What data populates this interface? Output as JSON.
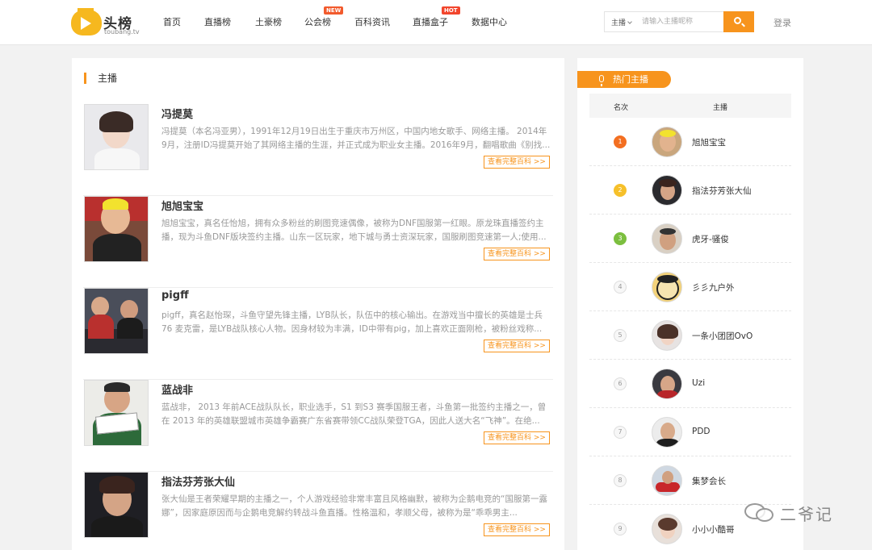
{
  "brand": {
    "name": "头榜",
    "sub": "toubang.tv"
  },
  "nav": [
    {
      "label": "首页"
    },
    {
      "label": "直播榜"
    },
    {
      "label": "土豪榜"
    },
    {
      "label": "公会榜",
      "badge": "NEW"
    },
    {
      "label": "百科资讯"
    },
    {
      "label": "直播盒子",
      "badge": "HOT"
    },
    {
      "label": "数据中心"
    }
  ],
  "search": {
    "category": "主播",
    "placeholder": "请输入主播昵称"
  },
  "login": "登录",
  "main": {
    "section_title": "主播",
    "more_label": "查看完整百科 >>",
    "items": [
      {
        "name": "冯提莫",
        "desc": "冯提莫（本名冯亚男），1991年12月19日出生于重庆市万州区，中国内地女歌手、网络主播。 2014年9月，注册ID冯提莫开始了其网络主播的生涯，并正式成为职业女主播。2016年9月，翻唱歌曲《别找..."
      },
      {
        "name": "旭旭宝宝",
        "desc": "旭旭宝宝，真名任怡旭，拥有众多粉丝的刷图竞速偶像，被称为DNF国服第一红眼。原龙珠直播签约主播，现为斗鱼DNF版块签约主播。山东一区玩家，地下城与勇士资深玩家，国服刷图竞速第一人;使用..."
      },
      {
        "name": "pigff",
        "desc": "pigff，真名赵怡琛，斗鱼守望先锋主播，LYB队长，队伍中的核心输出。在游戏当中擅长的英雄是士兵76 麦克雷，是LYB战队核心人物。因身材较为丰满，ID中带有pig，加上喜欢正面刚枪，被粉丝戏称..."
      },
      {
        "name": "蓝战非",
        "desc": "蓝战非， 2013 年前ACE战队队长，职业选手，S1 到S3 赛季国服王者，斗鱼第一批签约主播之一，曾在 2013 年的英雄联盟城市英雄争霸赛广东省赛带领CC战队荣登TGA，因此人送大名“飞神”。在绝..."
      },
      {
        "name": "指法芬芳张大仙",
        "desc": "张大仙是王者荣耀早期的主播之一，个人游戏经验非常丰富且风格幽默，被称为企鹅电竞的“国服第一露娜”，因家庭原因而与企鹅电竞解约转战斗鱼直播。性格温和，孝顺父母，被称为是“乖乖男主..."
      }
    ]
  },
  "sidebar": {
    "title": "热门主播",
    "col_rank": "名次",
    "col_anchor": "主播",
    "rows": [
      {
        "rank": "1",
        "name": "旭旭宝宝"
      },
      {
        "rank": "2",
        "name": "指法芬芳张大仙"
      },
      {
        "rank": "3",
        "name": "虎牙-骚俊"
      },
      {
        "rank": "4",
        "name": "彡彡九户外"
      },
      {
        "rank": "5",
        "name": "一条小团团OvO"
      },
      {
        "rank": "6",
        "name": "Uzi"
      },
      {
        "rank": "7",
        "name": "PDD"
      },
      {
        "rank": "8",
        "name": "集梦会长"
      },
      {
        "rank": "9",
        "name": "小小小酷哥"
      }
    ]
  },
  "watermark": "二爷记",
  "colors": {
    "accent": "#f7941d",
    "rank1": "#f36f21",
    "rank2": "#f6c02a",
    "rank3": "#7cbf3f"
  }
}
